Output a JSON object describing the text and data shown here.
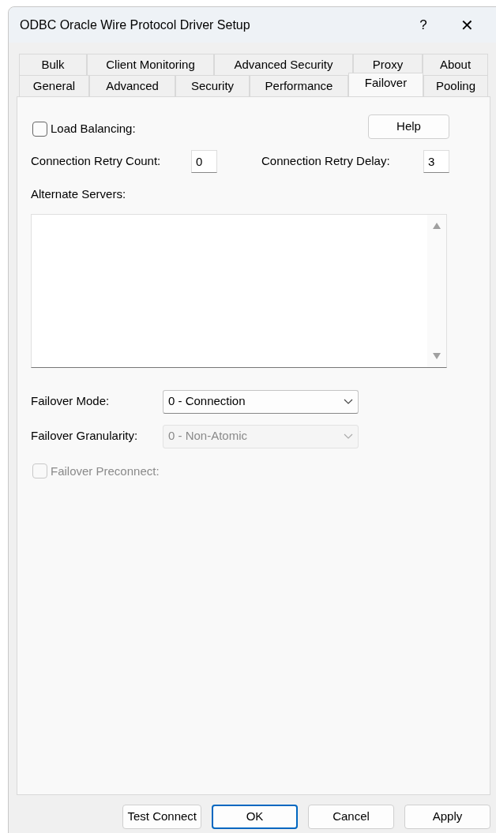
{
  "window": {
    "title": "ODBC Oracle Wire Protocol Driver Setup",
    "help_button": "?",
    "close_button": "✕"
  },
  "tab_rows": [
    [
      {
        "label": "Bulk",
        "selected": false
      },
      {
        "label": "Client Monitoring",
        "selected": false
      },
      {
        "label": "Advanced Security",
        "selected": false
      },
      {
        "label": "Proxy",
        "selected": false
      },
      {
        "label": "About",
        "selected": false
      }
    ],
    [
      {
        "label": "General",
        "selected": false
      },
      {
        "label": "Advanced",
        "selected": false
      },
      {
        "label": "Security",
        "selected": false
      },
      {
        "label": "Performance",
        "selected": false
      },
      {
        "label": "Failover",
        "selected": true
      },
      {
        "label": "Pooling",
        "selected": false
      }
    ]
  ],
  "load_balancing": {
    "label": "Load Balancing:",
    "checked": false,
    "disabled": false
  },
  "help_button": "Help",
  "retry_count": {
    "label": "Connection Retry Count:",
    "value": "0"
  },
  "retry_delay": {
    "label": "Connection Retry Delay:",
    "value": "3"
  },
  "alternate_servers": {
    "label": "Alternate Servers:"
  },
  "failover_mode": {
    "label": "Failover Mode:",
    "value": "0 - Connection",
    "disabled": false
  },
  "failover_granularity": {
    "label": "Failover Granularity:",
    "value": "0 - Non-Atomic",
    "disabled": true
  },
  "failover_preconnect": {
    "label": "Failover Preconnect:",
    "checked": false,
    "disabled": true
  },
  "buttons": [
    {
      "label": "Test Connect",
      "default": false
    },
    {
      "label": "OK",
      "default": true
    },
    {
      "label": "Cancel",
      "default": false
    },
    {
      "label": "Apply",
      "default": false
    }
  ]
}
